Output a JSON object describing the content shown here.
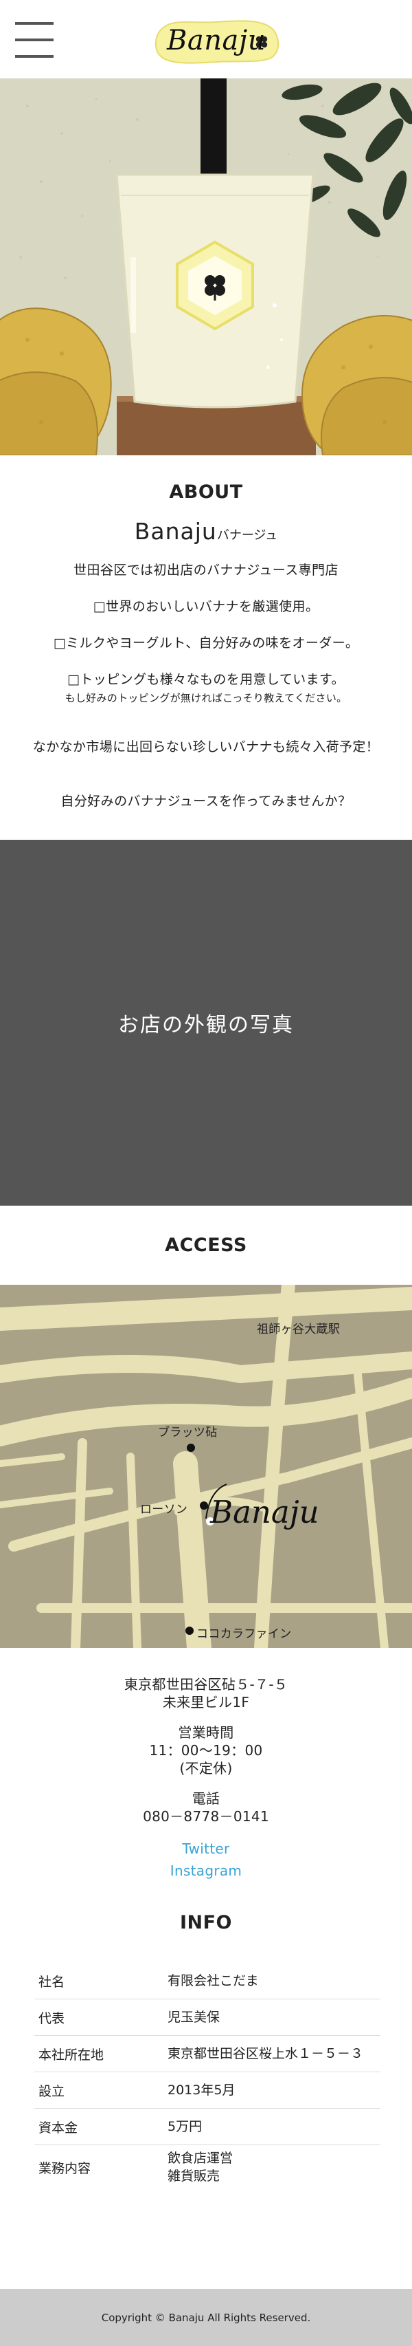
{
  "header": {
    "logo_text": "Banaju"
  },
  "about": {
    "title": "ABOUT",
    "brand": "Banaju",
    "brand_kana": "バナージュ",
    "lines": [
      "世田谷区では初出店のバナナジュース専門店",
      "□世界のおいしいバナナを厳選使用。",
      "□ミルクやヨーグルト、自分好みの味をオーダー。",
      "□トッピングも様々なものを用意しています。"
    ],
    "small_note": "もし好みのトッピングが無ければこっそり教えてください。",
    "extra": [
      "なかなか市場に出回らない珍しいバナナも続々入荷予定！",
      "自分好みのバナナジュースを作ってみませんか？"
    ]
  },
  "store_photo": {
    "label": "お店の外観の写真"
  },
  "access": {
    "title": "ACCESS",
    "map_labels": {
      "station": "祖師ヶ谷大蔵駅",
      "bullets": "ブラッツ砧",
      "lawson": "ローソン",
      "cocokara": "ココカラファイン",
      "brand": "Banaju"
    },
    "address": [
      "東京都世田谷区砧５-７-５",
      "未来里ビル1F"
    ],
    "hours_label": "営業時間",
    "hours": "11：00〜19：00",
    "closed": "(不定休)",
    "phone_label": "電話",
    "phone": "080－8778－0141",
    "links": [
      "Twitter",
      "Instagram"
    ]
  },
  "info": {
    "title": "INFO",
    "rows": [
      {
        "key": "社名",
        "value": "有限会社こだま"
      },
      {
        "key": "代表",
        "value": "児玉美保"
      },
      {
        "key": "本社所在地",
        "value": "東京都世田谷区桜上水１－５－３"
      },
      {
        "key": "設立",
        "value": "2013年5月"
      },
      {
        "key": "資本金",
        "value": "5万円"
      },
      {
        "key": "業務内容",
        "value": "飲食店運営",
        "value2": "雑貨販売"
      }
    ]
  },
  "footer": {
    "copyright": "Copyright © Banaju All Rights Reserved."
  },
  "colors": {
    "hero_bg": "#d9d9c3",
    "banana": "#d8b24a",
    "leaf": "#2f3b2b",
    "map_bg": "#a9a287",
    "map_road": "#e7e1b5",
    "link": "#3aa3d4",
    "photo_bg": "#555555",
    "footer_bg": "#cccccc"
  }
}
